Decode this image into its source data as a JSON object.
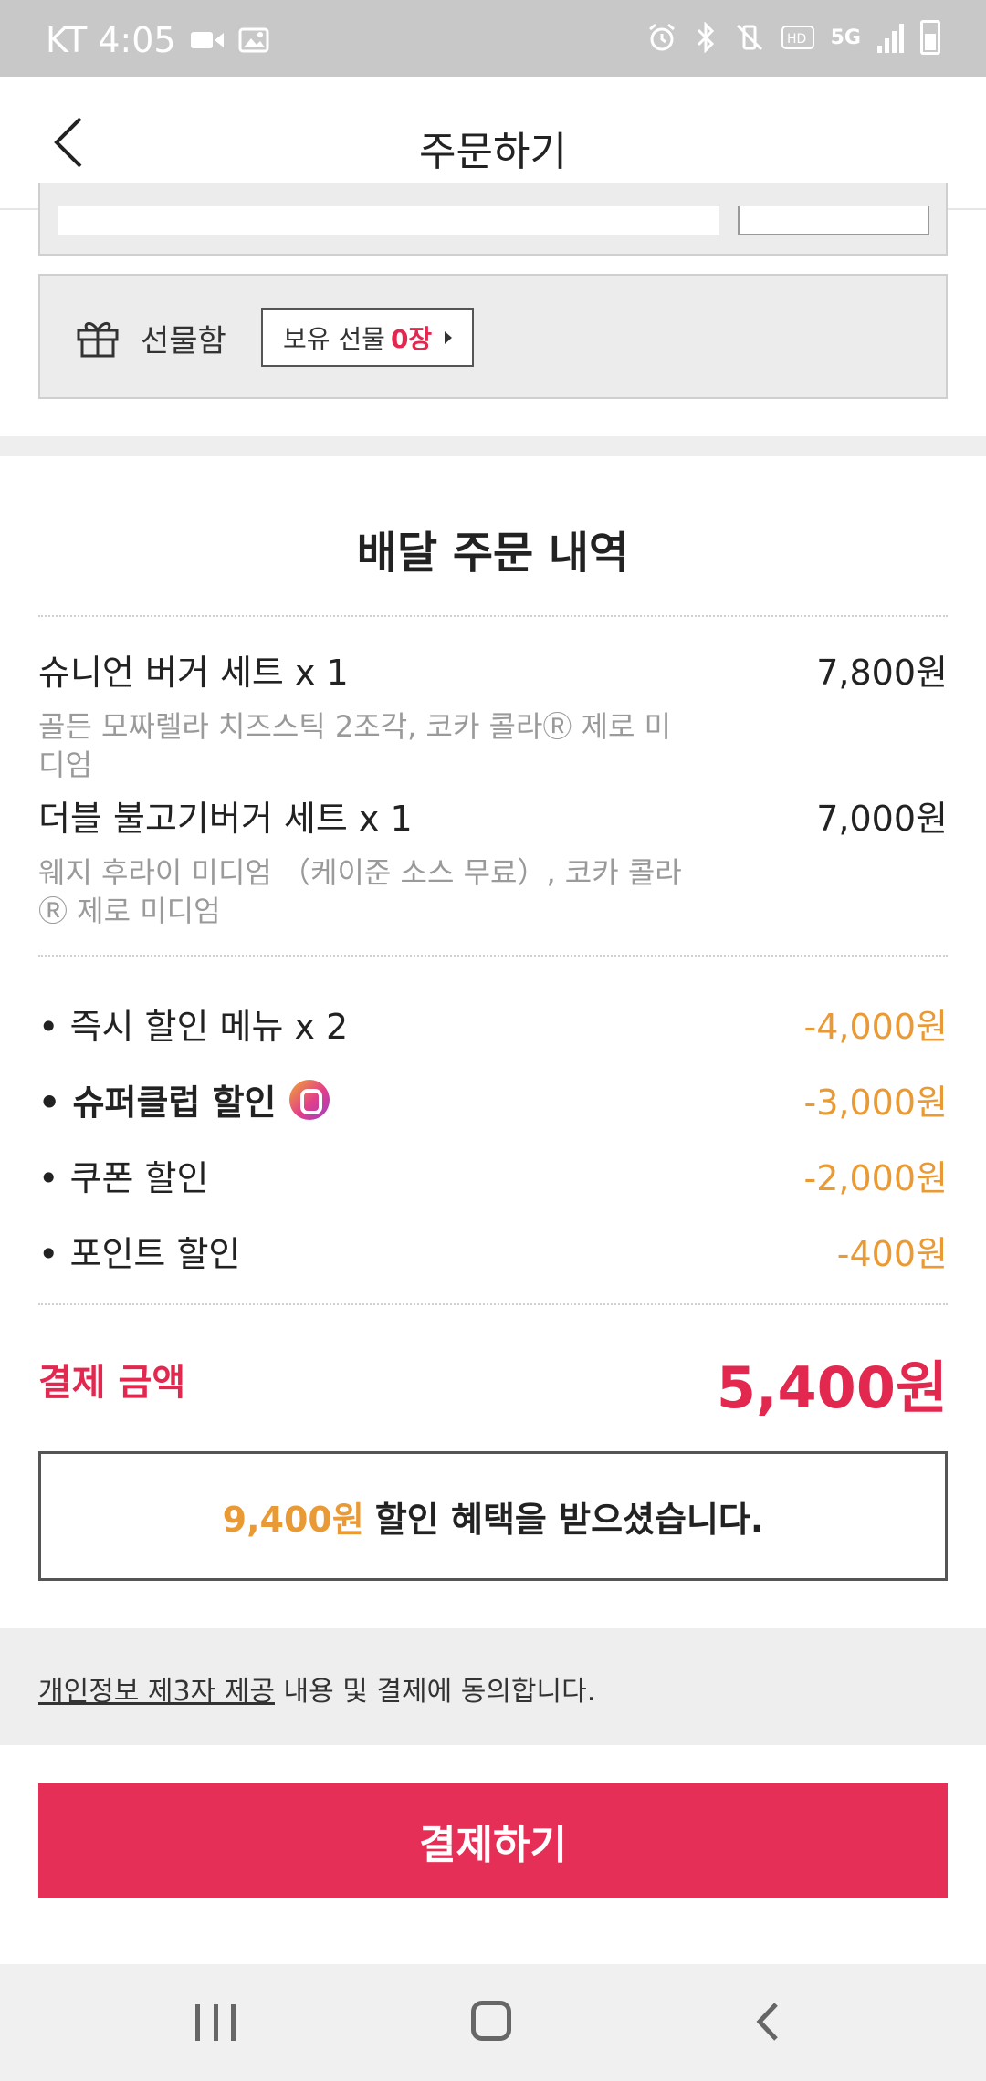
{
  "status_bar": {
    "time": "KT 4:05",
    "network": "5G"
  },
  "header": {
    "title": "주문하기"
  },
  "gift": {
    "label": "선물함",
    "button_prefix": "보유 선물 ",
    "count": "0장"
  },
  "order": {
    "title": "배달 주문 내역",
    "items": [
      {
        "name": "슈니언 버거 세트 x 1",
        "price": "7,800원",
        "options": "골든 모짜렐라 치즈스틱 2조각, 코카 콜라Ⓡ 제로 미디엄"
      },
      {
        "name": "더블 불고기버거 세트 x 1",
        "price": "7,000원",
        "options": "웨지 후라이 미디엄 （케이준 소스 무료）, 코카 콜라Ⓡ 제로 미디엄"
      }
    ],
    "discounts": [
      {
        "label": "• 즉시 할인 메뉴 x 2",
        "value": "-4,000원"
      },
      {
        "label": "• 슈퍼클럽 할인",
        "value": "-3,000원"
      },
      {
        "label": "• 쿠폰 할인",
        "value": "-2,000원"
      },
      {
        "label": "• 포인트 할인",
        "value": "-400원"
      }
    ],
    "payment_label": "결제 금액",
    "payment_amount": "5,400원",
    "benefit_amount": "9,400원",
    "benefit_text": "할인 혜택을 받으셨습니다."
  },
  "consent": {
    "link_text": "개인정보 제3자 제공",
    "rest_text": " 내용 및 결제에 동의합니다."
  },
  "pay_button": "결제하기",
  "colors": {
    "accent": "#e52f56",
    "discount": "#ea9a34"
  }
}
